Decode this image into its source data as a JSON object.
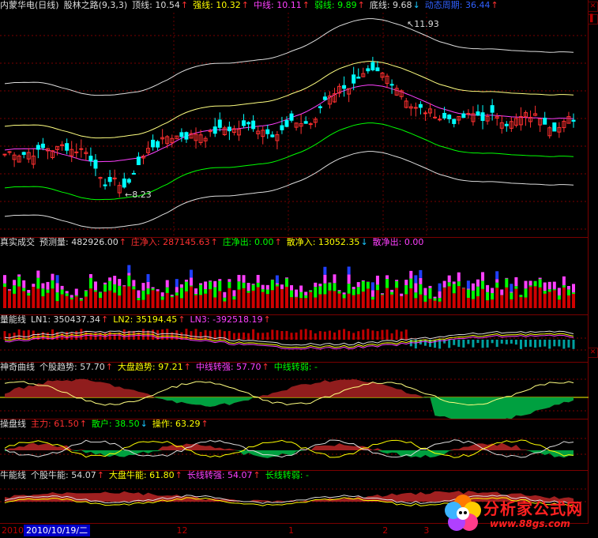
{
  "main": {
    "stock": "内蒙华电(日线)",
    "indicator": "股林之路(9,3,3)",
    "values": [
      {
        "label": "顶线:",
        "value": "10.54",
        "arrow": "↑",
        "color": "#dddddd"
      },
      {
        "label": "强线:",
        "value": "10.32",
        "arrow": "↑",
        "color": "#ffff00"
      },
      {
        "label": "中线:",
        "value": "10.11",
        "arrow": "↑",
        "color": "#ff40ff"
      },
      {
        "label": "弱线:",
        "value": "9.89",
        "arrow": "↑",
        "color": "#00ff00"
      },
      {
        "label": "底线:",
        "value": "9.68",
        "arrow": "↓",
        "color": "#dddddd"
      },
      {
        "label": "动态周期:",
        "value": "36.44",
        "arrow": "↑",
        "color": "#3060ff"
      }
    ],
    "high_label": "11.93",
    "low_label": "8.23"
  },
  "p2": {
    "title": "真实成交",
    "values": [
      {
        "label": "预测量:",
        "value": "482926.00",
        "arrow": "↑",
        "color": "#dddddd"
      },
      {
        "label": "庄净入:",
        "value": "287145.63",
        "arrow": "↑",
        "color": "#ff3030"
      },
      {
        "label": "庄净出:",
        "value": "0.00",
        "arrow": "↑",
        "color": "#00ff00"
      },
      {
        "label": "散净入:",
        "value": "13052.35",
        "arrow": "↓",
        "color": "#ffff00"
      },
      {
        "label": "散净出:",
        "value": "0.00",
        "arrow": "",
        "color": "#ff40ff"
      }
    ]
  },
  "p3": {
    "title": "量能线",
    "values": [
      {
        "label": "LN1:",
        "value": "350437.34",
        "arrow": "↑",
        "color": "#dddddd"
      },
      {
        "label": "LN2:",
        "value": "35194.45",
        "arrow": "↑",
        "color": "#ffff00"
      },
      {
        "label": "LN3:",
        "value": "-392518.19",
        "arrow": "↑",
        "color": "#ff40ff"
      }
    ]
  },
  "p4": {
    "title": "神奇曲线",
    "values": [
      {
        "label": "个股趋势:",
        "value": "57.70",
        "arrow": "↑",
        "color": "#dddddd"
      },
      {
        "label": "大盘趋势:",
        "value": "97.21",
        "arrow": "↑",
        "color": "#ffff00"
      },
      {
        "label": "中线转强:",
        "value": "57.70",
        "arrow": "↑",
        "color": "#ff40ff"
      },
      {
        "label": "中线转弱:",
        "value": "-",
        "arrow": "",
        "color": "#00ff00"
      }
    ]
  },
  "p5": {
    "title": "操盘线",
    "values": [
      {
        "label": "主力:",
        "value": "61.50",
        "arrow": "↑",
        "color": "#ff3030"
      },
      {
        "label": "散户:",
        "value": "38.50",
        "arrow": "↓",
        "color": "#00ff00"
      },
      {
        "label": "操作:",
        "value": "63.29",
        "arrow": "↑",
        "color": "#ffff00"
      }
    ]
  },
  "p6": {
    "title": "牛能线",
    "values": [
      {
        "label": "个股牛能:",
        "value": "54.07",
        "arrow": "↑",
        "color": "#dddddd"
      },
      {
        "label": "大盘牛能:",
        "value": "61.80",
        "arrow": "↑",
        "color": "#ffff00"
      },
      {
        "label": "长线转强:",
        "value": "54.07",
        "arrow": "↑",
        "color": "#ff40ff"
      },
      {
        "label": "长线转弱:",
        "value": "-",
        "arrow": "",
        "color": "#00ff00"
      }
    ]
  },
  "status": {
    "date": "2010/10/19/二",
    "ticks": [
      {
        "label": "12",
        "pos": 0.3
      },
      {
        "label": "1",
        "pos": 0.49
      },
      {
        "label": "2",
        "pos": 0.65
      },
      {
        "label": "3",
        "pos": 0.72
      }
    ]
  },
  "logo": {
    "name": "分析家公式网",
    "url": "www.88gs.com"
  }
}
